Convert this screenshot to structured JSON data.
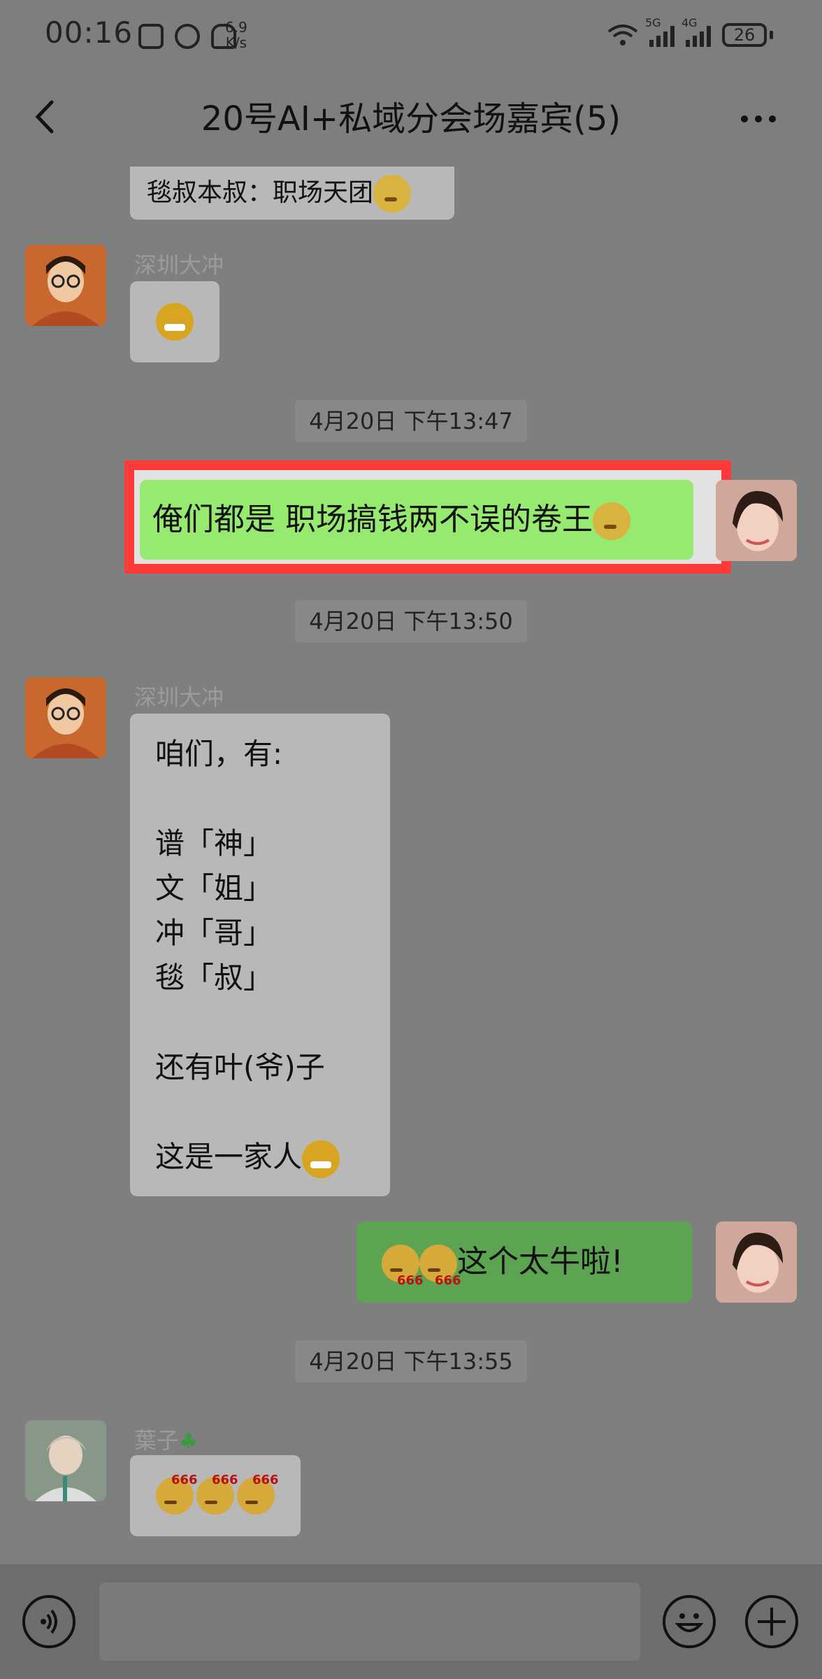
{
  "status_bar": {
    "time": "00:16",
    "net_speed_value": "6.9",
    "net_speed_unit": "K/s",
    "signal1_label": "5G",
    "signal2_label": "4G",
    "battery": "26"
  },
  "header": {
    "title": "20号AI+私域分会场嘉宾(5)"
  },
  "messages": {
    "m1_text": "毯叔本叔：职场天团",
    "m2_sender": "深圳大冲",
    "ts1": "4月20日 下午13:47",
    "m3_text": "俺们都是 职场搞钱两不误的卷王",
    "ts2": "4月20日 下午13:50",
    "m4_sender": "深圳大冲",
    "m4_lines": [
      "咱们，有:",
      "",
      "谱「神」",
      "文「姐」",
      "冲「哥」",
      "毯「叔」",
      "",
      "还有叶(爷)子",
      "",
      "这是一家人"
    ],
    "m5_text": "这个太牛啦!",
    "ts3": "4月20日 下午13:55",
    "m6_sender": "葉子"
  },
  "icons": {
    "voice": "voice-icon",
    "emoji": "emoji-icon",
    "plus": "plus-icon",
    "back": "back-arrow-icon",
    "more": "more-icon"
  }
}
